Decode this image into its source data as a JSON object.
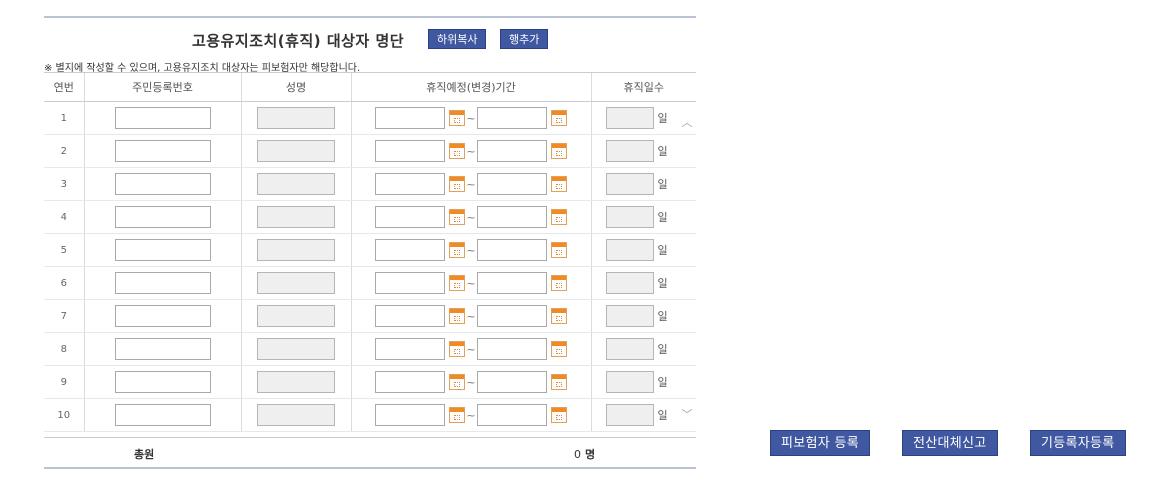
{
  "header": {
    "title": "고용유지조치(휴직) 대상자 명단",
    "copy_button": "하위복사",
    "add_row_button": "행추가"
  },
  "note": "※ 별지에 작성할 수 있으며, 고용유지조치 대상자는 피보험자만 해당합니다.",
  "columns": [
    "연번",
    "주민등록번호",
    "성명",
    "휴직예정(변경)기간",
    "휴직일수"
  ],
  "rows": [
    {
      "no": "1",
      "unit": "일",
      "tilde": "~"
    },
    {
      "no": "2",
      "unit": "일",
      "tilde": "~"
    },
    {
      "no": "3",
      "unit": "일",
      "tilde": "~"
    },
    {
      "no": "4",
      "unit": "일",
      "tilde": "~"
    },
    {
      "no": "5",
      "unit": "일",
      "tilde": "~"
    },
    {
      "no": "6",
      "unit": "일",
      "tilde": "~"
    },
    {
      "no": "7",
      "unit": "일",
      "tilde": "~"
    },
    {
      "no": "8",
      "unit": "일",
      "tilde": "~"
    },
    {
      "no": "9",
      "unit": "일",
      "tilde": "~"
    },
    {
      "no": "10",
      "unit": "일",
      "tilde": "~"
    }
  ],
  "summary": {
    "label": "총원",
    "value": "0",
    "unit": "명"
  },
  "actions": {
    "register": "피보험자 등록",
    "submit": "전산대체신고",
    "existing": "기등록자등록"
  },
  "icons": {
    "calendar": "calendar-icon",
    "scroll_up": "chevron-up-icon",
    "scroll_down": "chevron-down-icon"
  },
  "colors": {
    "button": "#3f58a1",
    "calendar_accent": "#f08a24"
  }
}
